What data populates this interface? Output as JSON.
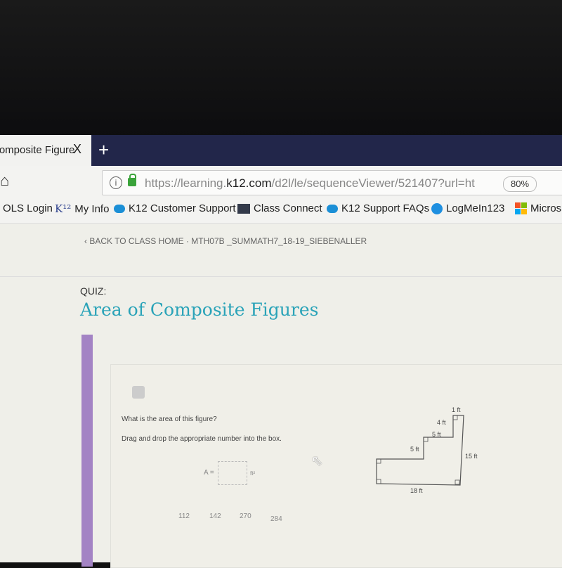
{
  "browser": {
    "tab_title": "Composite Figure",
    "tab_close": "X",
    "new_tab": "+",
    "url_host": "https://learning.",
    "url_domain": "k12.com",
    "url_path": "/d2l/le/sequenceViewer/521407?url=ht",
    "zoom": "80%",
    "bookmarks": [
      {
        "label": "OLS Login",
        "icon": "none"
      },
      {
        "label": "My Info",
        "icon": "k12-logo"
      },
      {
        "label": "K12 Customer Support",
        "icon": "salesforce-cloud-icon"
      },
      {
        "label": "Class Connect",
        "icon": "video-icon"
      },
      {
        "label": "K12 Support FAQs",
        "icon": "salesforce-cloud-icon"
      },
      {
        "label": "LogMeIn123",
        "icon": "logmein-icon"
      },
      {
        "label": "Micros",
        "icon": "microsoft-logo"
      }
    ]
  },
  "page": {
    "breadcrumb_back": "BACK TO CLASS HOME",
    "breadcrumb_course": "· MTH07B _SUMMATH7_18-19_SIEBENALLER",
    "quiz_label": "QUIZ:",
    "title": "Area of Composite Figures"
  },
  "question": {
    "prompt": "What is the area of this figure?",
    "instructions": "Drag and drop the appropriate number into the box.",
    "answer_label": "A =",
    "unit": "ft²",
    "options": [
      "112",
      "142",
      "270",
      "284"
    ],
    "figure_labels": {
      "top": "1 ft",
      "step_vertical": "4 ft",
      "step_horizontal": "5 ft",
      "left_vertical": "5 ft",
      "right": "15 ft",
      "bottom": "18 ft"
    }
  }
}
